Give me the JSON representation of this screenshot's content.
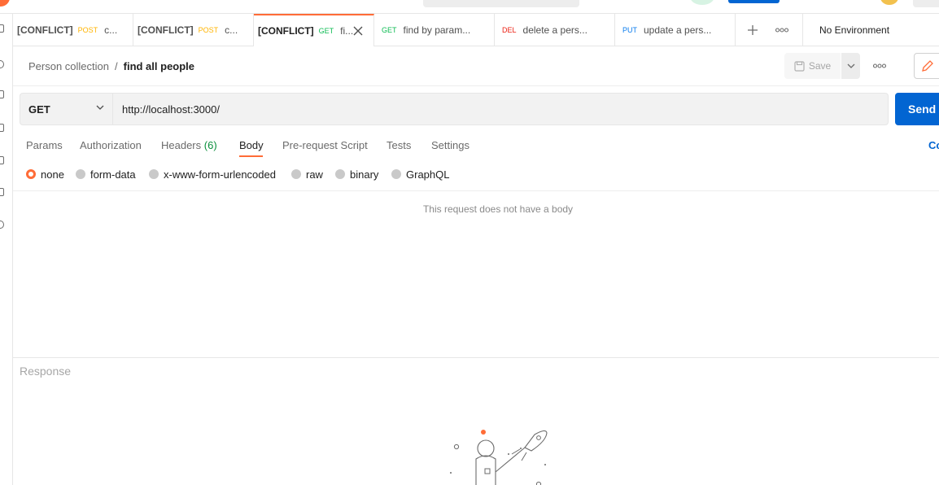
{
  "tabs": [
    {
      "conflict": "[CONFLICT]",
      "method": "POST",
      "name": "c..."
    },
    {
      "conflict": "[CONFLICT]",
      "method": "POST",
      "name": "c..."
    },
    {
      "conflict": "[CONFLICT]",
      "method": "GET",
      "name": "fi..."
    },
    {
      "conflict": "",
      "method": "GET",
      "name": "find by param..."
    },
    {
      "conflict": "",
      "method": "DEL",
      "name": "delete a pers..."
    },
    {
      "conflict": "",
      "method": "PUT",
      "name": "update a pers..."
    }
  ],
  "environment": "No Environment",
  "breadcrumb": {
    "collection": "Person collection",
    "separator": "/",
    "request": "find all people"
  },
  "save_label": "Save",
  "request": {
    "method": "GET",
    "url": "http://localhost:3000/",
    "send_label": "Send"
  },
  "subtabs": {
    "params": "Params",
    "authorization": "Authorization",
    "headers": "Headers",
    "headers_count": "(6)",
    "body": "Body",
    "prerequest": "Pre-request Script",
    "tests": "Tests",
    "settings": "Settings",
    "cookies": "Cookies"
  },
  "body_types": [
    "none",
    "form-data",
    "x-www-form-urlencoded",
    "raw",
    "binary",
    "GraphQL"
  ],
  "body_selected": "none",
  "no_body_message": "This request does not have a body",
  "response_label": "Response",
  "colors": {
    "accent": "#ff6c37",
    "send": "#0265d2",
    "post": "#ffb400",
    "get": "#0cbb52",
    "del": "#eb2013",
    "put": "#097bed"
  }
}
